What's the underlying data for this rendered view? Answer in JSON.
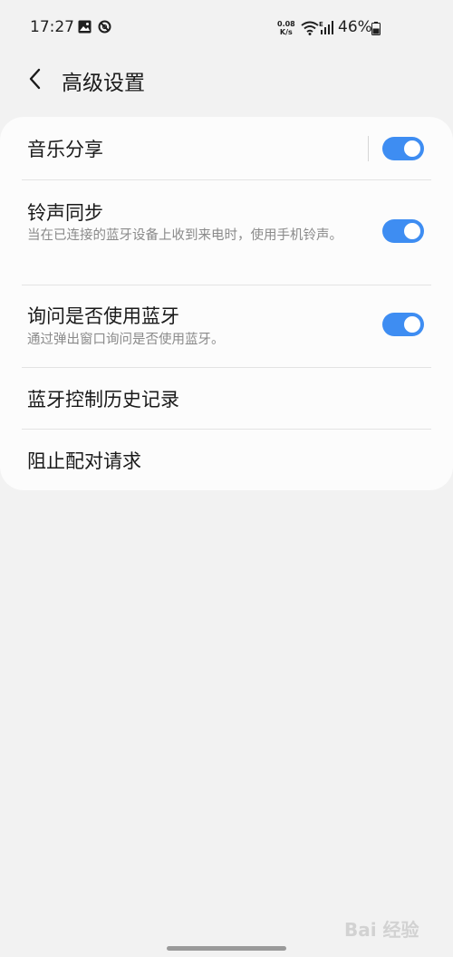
{
  "status_bar": {
    "time": "17:27",
    "network_speed_value": "0.08",
    "network_speed_unit": "K/s",
    "signal_label": "E",
    "battery_percent": "46%",
    "icons": [
      "image-icon",
      "blocked-icon",
      "wifi-icon",
      "signal-icon",
      "battery-icon"
    ]
  },
  "header": {
    "title": "高级设置",
    "back_icon": "chevron-left-icon"
  },
  "settings": [
    {
      "title": "音乐分享",
      "subtitle": "",
      "toggle_on": true
    },
    {
      "title": "铃声同步",
      "subtitle": "当在已连接的蓝牙设备上收到来电时，使用手机铃声。",
      "toggle_on": true
    },
    {
      "title": "询问是否使用蓝牙",
      "subtitle": "通过弹出窗口询问是否使用蓝牙。",
      "toggle_on": true
    },
    {
      "title": "蓝牙控制历史记录",
      "subtitle": ""
    },
    {
      "title": "阻止配对请求",
      "subtitle": ""
    }
  ],
  "colors": {
    "accent": "#3e8df2",
    "background": "#f2f2f2",
    "card": "#fcfcfc"
  },
  "watermark": {
    "text": "Bai 经验"
  }
}
